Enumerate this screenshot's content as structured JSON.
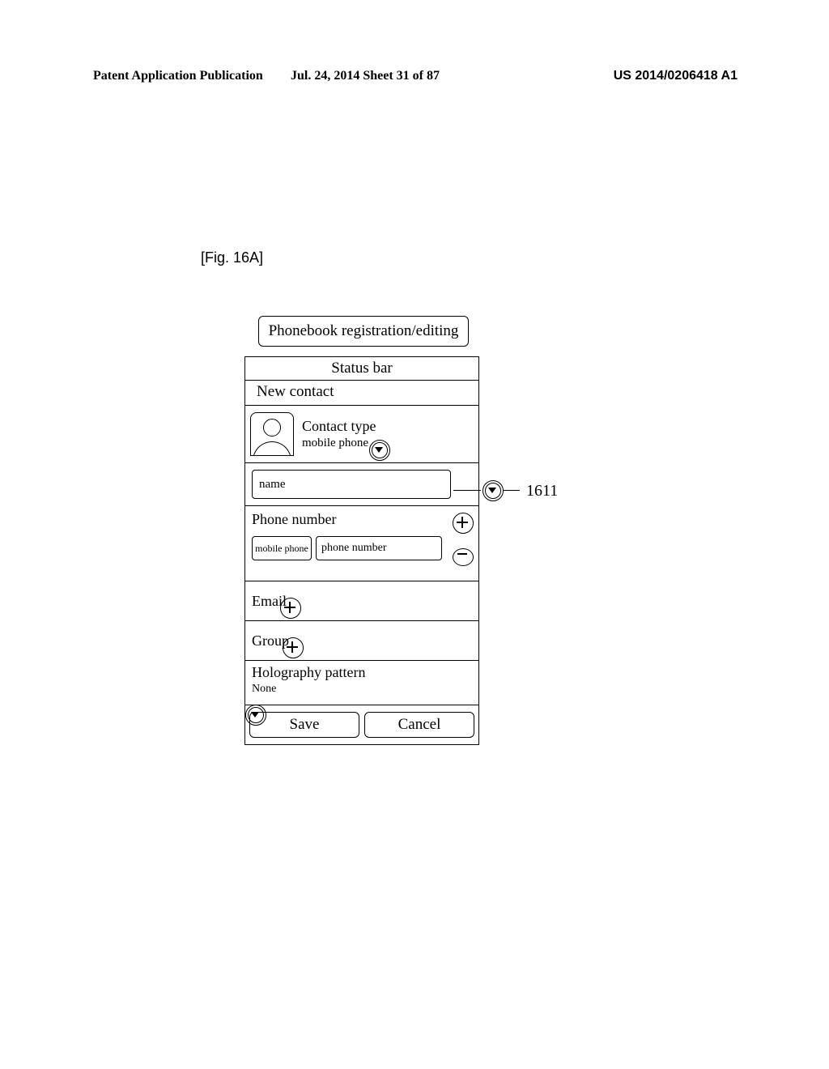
{
  "header": {
    "left": "Patent Application Publication",
    "middle": "Jul. 24, 2014  Sheet 31 of 87",
    "right": "US 2014/0206418 A1"
  },
  "figure_label": "[Fig. 16A]",
  "ui": {
    "title_tab": "Phonebook registration/editing",
    "status_bar": "Status bar",
    "new_contact": "New contact",
    "contact_type": {
      "label": "Contact type",
      "value": "mobile phone"
    },
    "name_placeholder": "name",
    "phone": {
      "label": "Phone number",
      "type": "mobile phone",
      "placeholder": "phone number"
    },
    "email_label": "Email",
    "group_label": "Group",
    "holography": {
      "label": "Holography pattern",
      "value": "None"
    },
    "buttons": {
      "save": "Save",
      "cancel": "Cancel"
    }
  },
  "callout": "1611"
}
